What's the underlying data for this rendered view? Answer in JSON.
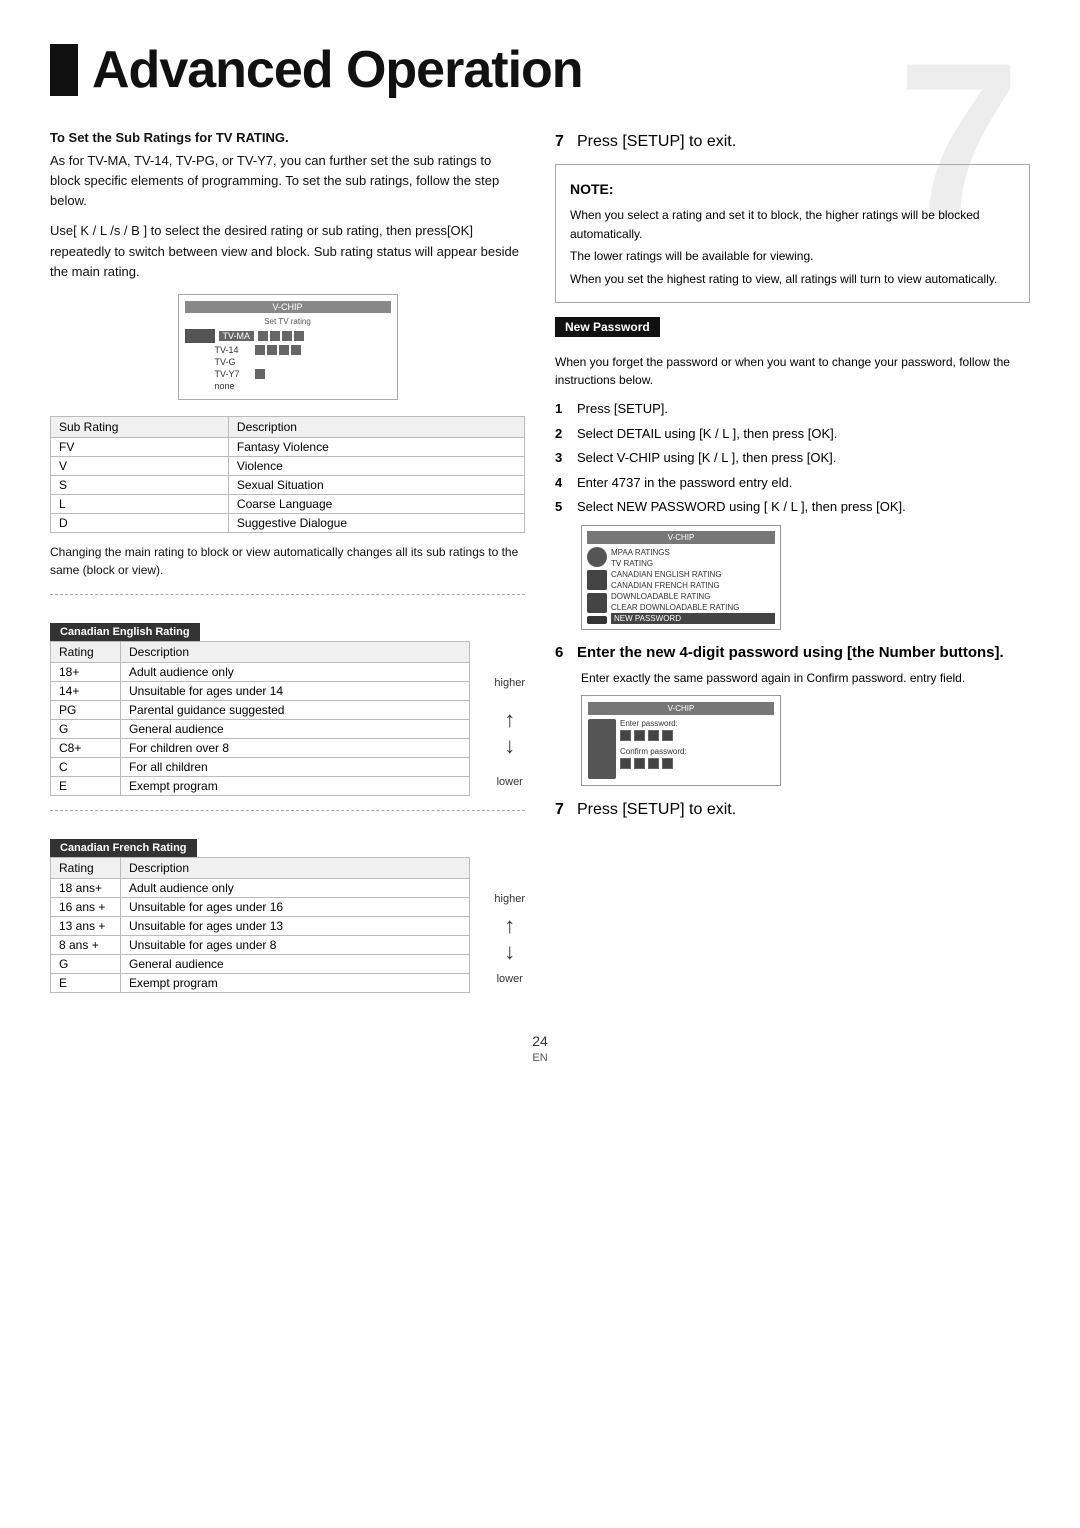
{
  "page": {
    "bg_number": "7",
    "title": "Advanced Operation",
    "page_number": "24",
    "en_label": "EN"
  },
  "left_col": {
    "intro_title": "To Set the Sub Ratings for TV RATING.",
    "intro_text1": "As for TV-MA, TV-14, TV-PG, or TV-Y7, you can further set the sub ratings to block specific elements of programming. To set the sub ratings, follow the step below.",
    "intro_text2": "Use[ K / L  /s  / B  ] to select the desired rating or sub rating, then press[OK] repeatedly to switch between view and block. Sub rating status will appear beside the main rating.",
    "vchip_header": "V-CHIP",
    "vchip_sub_header": "Set TV rating",
    "vchip_rows": [
      {
        "label": "TV-MA",
        "blocks": [
          true,
          true,
          true,
          true
        ]
      },
      {
        "label": "TV-14",
        "blocks": [
          true,
          true,
          true,
          true
        ]
      },
      {
        "label": "TV-G",
        "blocks": []
      },
      {
        "label": "TV-Y7",
        "blocks": [
          true
        ]
      },
      {
        "label": "none",
        "blocks": []
      }
    ],
    "sub_rating_table": {
      "col1": "Sub Rating",
      "col2": "Description",
      "rows": [
        {
          "sub": "FV",
          "desc": "Fantasy Violence"
        },
        {
          "sub": "V",
          "desc": "Violence"
        },
        {
          "sub": "S",
          "desc": "Sexual Situation"
        },
        {
          "sub": "L",
          "desc": "Coarse Language"
        },
        {
          "sub": "D",
          "desc": "Suggestive Dialogue"
        }
      ]
    },
    "sub_rating_note": "Changing the main rating to block or view automatically changes all its sub ratings to the same (block or view).",
    "canadian_english_label": "Canadian English Rating",
    "canadian_english_table": {
      "col1": "Rating",
      "col2": "Description",
      "rows": [
        {
          "rating": "18+",
          "desc": "Adult audience only",
          "position": "higher"
        },
        {
          "rating": "14+",
          "desc": "Unsuitable for ages under 14",
          "position": ""
        },
        {
          "rating": "PG",
          "desc": "Parental guidance suggested",
          "position": ""
        },
        {
          "rating": "G",
          "desc": "General audience",
          "position": ""
        },
        {
          "rating": "C8+",
          "desc": "For children over 8",
          "position": ""
        },
        {
          "rating": "C",
          "desc": "For all children",
          "position": "lower"
        },
        {
          "rating": "E",
          "desc": "Exempt program",
          "position": ""
        }
      ]
    },
    "canadian_french_label": "Canadian French Rating",
    "canadian_french_table": {
      "col1": "Rating",
      "col2": "Description",
      "rows": [
        {
          "rating": "18 ans+",
          "desc": "Adult audience only",
          "position": "higher"
        },
        {
          "rating": "16 ans +",
          "desc": "Unsuitable for ages under 16",
          "position": ""
        },
        {
          "rating": "13 ans +",
          "desc": "Unsuitable for ages under 13",
          "position": ""
        },
        {
          "rating": "8 ans +",
          "desc": "Unsuitable for ages under 8",
          "position": ""
        },
        {
          "rating": "G",
          "desc": "General audience",
          "position": "lower"
        },
        {
          "rating": "E",
          "desc": "Exempt program",
          "position": ""
        }
      ]
    },
    "higher": "higher",
    "lower": "lower"
  },
  "right_col": {
    "step7_label": "7",
    "step7_text": "Press [SETUP] to exit.",
    "note_title": "NOTE:",
    "note_text1": "When you select a rating and set it to block, the higher ratings will be blocked automatically.",
    "note_text2": "The lower ratings will be available for viewing.",
    "note_text3": "When you set the highest rating to view, all ratings will turn to view automatically.",
    "new_password_label": "New Password",
    "new_password_intro": "When you forget the password or when you want to change your password, follow the instructions below.",
    "steps": [
      {
        "num": "1",
        "text": "Press [SETUP]."
      },
      {
        "num": "2",
        "text": "Select  DETAIL  using [K / L ], then press [OK]."
      },
      {
        "num": "3",
        "text": "Select  V-CHIP  using [K / L ], then press [OK]."
      },
      {
        "num": "4",
        "text": "Enter 4737 in the password entry eld."
      },
      {
        "num": "5",
        "text": "Select  NEW PASSWORD  using [ K / L ], then press [OK]."
      }
    ],
    "vchip_menu_header": "V-CHIP",
    "vchip_menu_items": [
      "MPAA RATINGS",
      "TV RATING",
      "CANADIAN ENGLISH RATING",
      "CANADIAN FRENCH RATING",
      "DOWNLOADABLE RATING",
      "CLEAR DOWNLOADABLE RATING",
      "NEW PASSWORD"
    ],
    "step6_text": "Enter the new 4-digit password using [the Number buttons].",
    "step6_sub": "Enter exactly the same password again in Confirm password. entry field.",
    "password_label1": "Enter password:",
    "password_label2": "Confirm password:",
    "step7b_label": "7",
    "step7b_text": "Press [SETUP] to exit."
  }
}
